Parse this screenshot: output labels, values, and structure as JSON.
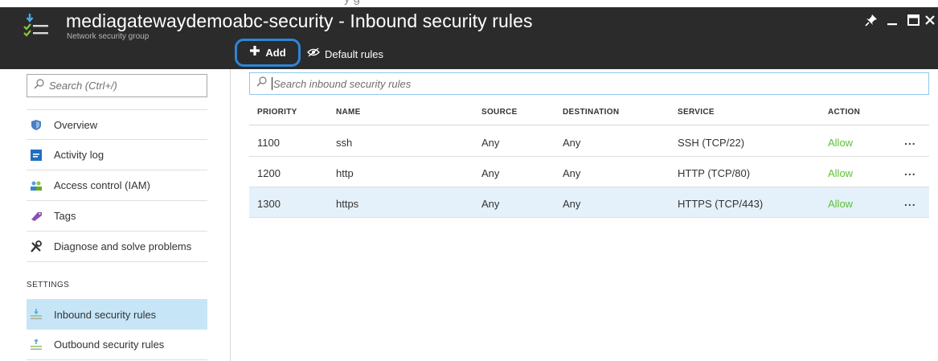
{
  "header": {
    "title": "mediagatewaydemoabc-security - Inbound security rules",
    "subtitle": "Network security group",
    "clipped_text_above": "y        g"
  },
  "window_controls": {
    "pin_icon": "pin-icon",
    "minimize_icon": "minimize-icon",
    "maximize_icon": "maximize-icon",
    "close_icon": "close-icon"
  },
  "commands": {
    "add_label": "Add",
    "default_rules_label": "Default rules"
  },
  "sidebar": {
    "search_placeholder": "Search (Ctrl+/)",
    "items": [
      {
        "label": "Overview",
        "icon": "shield-icon"
      },
      {
        "label": "Activity log",
        "icon": "activity-log-icon"
      },
      {
        "label": "Access control (IAM)",
        "icon": "users-icon"
      },
      {
        "label": "Tags",
        "icon": "tag-icon"
      },
      {
        "label": "Diagnose and solve problems",
        "icon": "wrench-icon"
      }
    ],
    "settings_heading": "SETTINGS",
    "settings_items": [
      {
        "label": "Inbound security rules",
        "icon": "inbound-rules-icon",
        "selected": true
      },
      {
        "label": "Outbound security rules",
        "icon": "outbound-rules-icon",
        "selected": false
      }
    ]
  },
  "main": {
    "search_placeholder": "Search inbound security rules",
    "columns": [
      "PRIORITY",
      "NAME",
      "SOURCE",
      "DESTINATION",
      "SERVICE",
      "ACTION"
    ],
    "rows": [
      {
        "priority": "1100",
        "name": "ssh",
        "source": "Any",
        "destination": "Any",
        "service": "SSH (TCP/22)",
        "action": "Allow",
        "more": "..."
      },
      {
        "priority": "1200",
        "name": "http",
        "source": "Any",
        "destination": "Any",
        "service": "HTTP (TCP/80)",
        "action": "Allow",
        "more": "..."
      },
      {
        "priority": "1300",
        "name": "https",
        "source": "Any",
        "destination": "Any",
        "service": "HTTPS (TCP/443)",
        "action": "Allow",
        "more": "..."
      }
    ],
    "selected_row": 2
  },
  "colors": {
    "header_bg": "#2b2b2b",
    "accent_blue": "#2c86d6",
    "selected_bg": "#c6e6f8",
    "allow_green": "#5ec232"
  }
}
